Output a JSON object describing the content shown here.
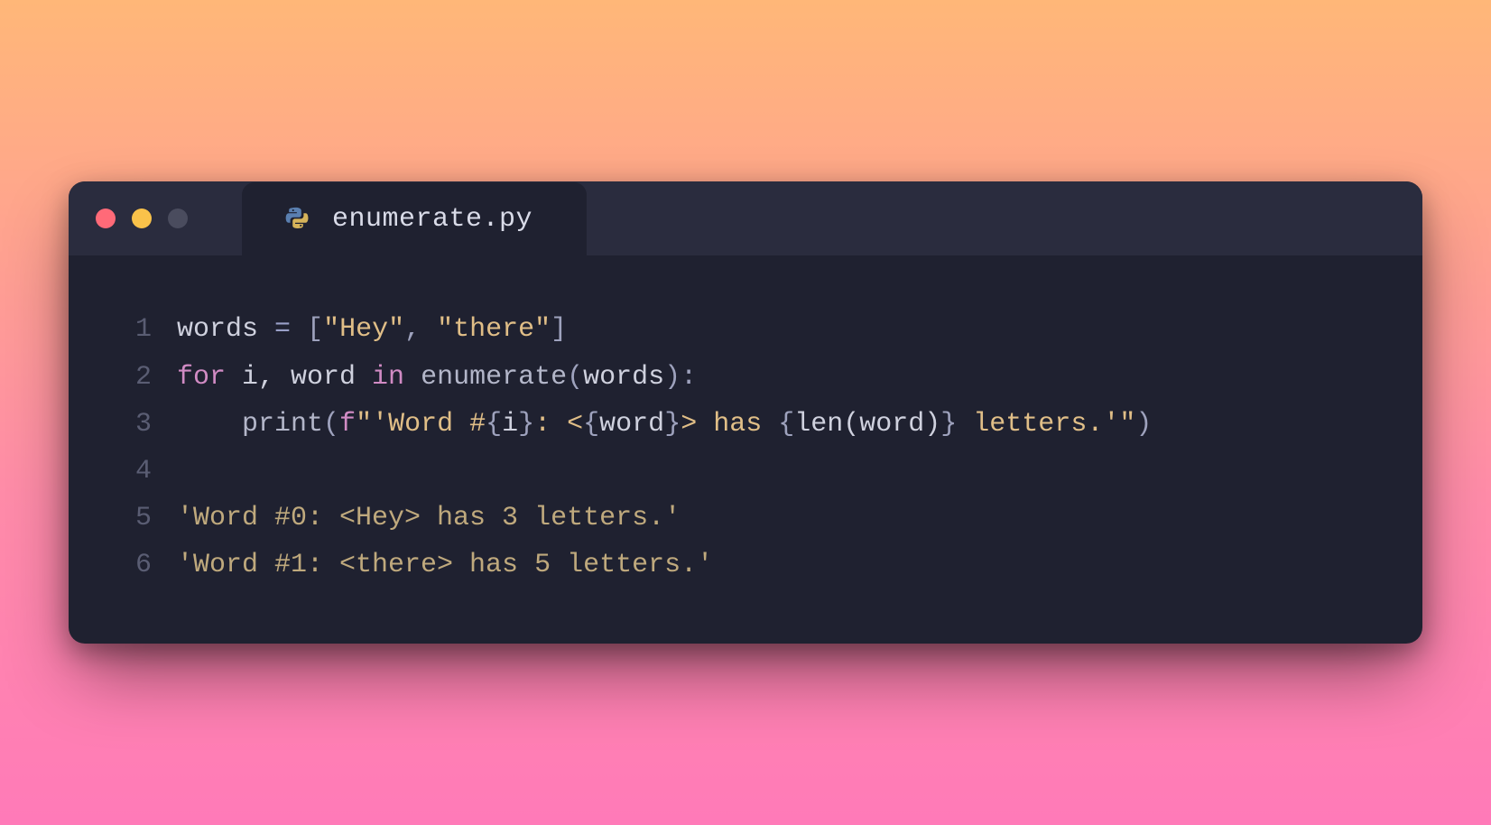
{
  "window": {
    "tab_filename": "enumerate.py",
    "traffic_colors": {
      "red": "#ff6a78",
      "yellow": "#f9c24a",
      "gray": "#4a4c5e"
    }
  },
  "code": {
    "line_numbers": [
      "1",
      "2",
      "3",
      "4",
      "5",
      "6"
    ],
    "line1": {
      "t1": "words ",
      "op": "=",
      "sp1": " ",
      "br1": "[",
      "s1": "\"Hey\"",
      "comma": ", ",
      "s2": "\"there\"",
      "br2": "]"
    },
    "line2": {
      "kw_for": "for",
      "sp1": " i, word ",
      "kw_in": "in",
      "sp2": " ",
      "fn": "enumerate",
      "paren1": "(",
      "arg": "words",
      "paren2": "):"
    },
    "line3": {
      "indent": "    ",
      "fn": "print",
      "paren1": "(",
      "fprefix": "f",
      "str_open": "\"'Word #",
      "brace1": "{",
      "var_i": "i",
      "brace1c": "}",
      "mid1": ": <",
      "brace2": "{",
      "var_word": "word",
      "brace2c": "}",
      "mid2": "> has ",
      "brace3": "{",
      "len_call": "len(word)",
      "brace3c": "}",
      "str_close": " letters.'\"",
      "paren2": ")"
    },
    "line4": "",
    "line5": "'Word #0: <Hey> has 3 letters.'",
    "line6": "'Word #1: <there> has 5 letters.'"
  }
}
